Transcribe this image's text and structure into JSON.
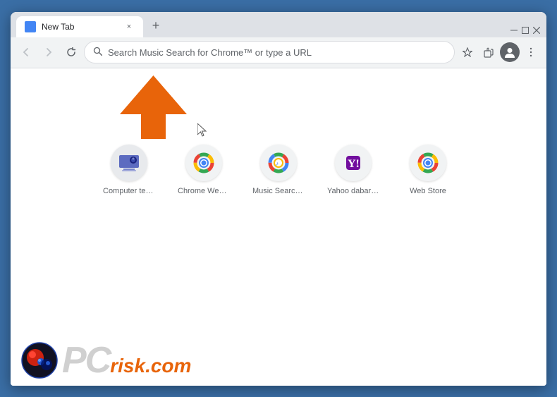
{
  "browser": {
    "tab": {
      "title": "New Tab",
      "close_btn": "×",
      "new_tab_btn": "+"
    },
    "window_controls": {
      "minimize": "—",
      "maximize": "□",
      "close": "×"
    },
    "toolbar": {
      "back_btn": "←",
      "forward_btn": "→",
      "reload_btn": "↺",
      "address_placeholder": "Search Music Search for Chrome™ or type a URL",
      "bookmark_icon": "☆",
      "extension_icon": "🧩",
      "menu_icon": "⋮"
    }
  },
  "shortcuts": [
    {
      "label": "Computer tec...",
      "type": "computer"
    },
    {
      "label": "Chrome Web ...",
      "type": "chrome"
    },
    {
      "label": "Music Search ...",
      "type": "music"
    },
    {
      "label": "Yahoo dabar y...",
      "type": "yahoo"
    },
    {
      "label": "Web Store",
      "type": "webstore"
    }
  ],
  "watermark": {
    "text_gray": "PC",
    "text_orange": "risk.com"
  }
}
